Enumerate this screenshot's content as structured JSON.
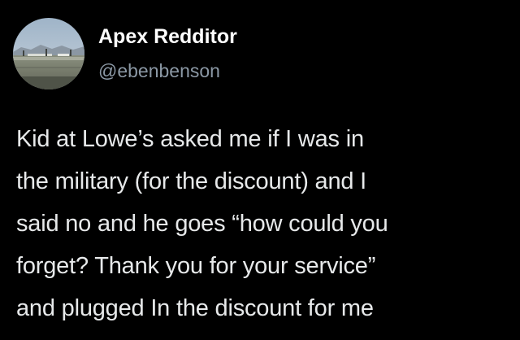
{
  "author": {
    "display_name": "Apex Redditor",
    "handle": "@ebenbenson",
    "avatar_icon": "avatar-landscape-photo"
  },
  "tweet": {
    "lines": [
      "Kid at Lowe’s asked me if I was in",
      "the military (for the discount) and I",
      "said no and he goes “how could you",
      "forget? Thank you for your service”",
      "and plugged In the discount for me"
    ]
  },
  "colors": {
    "background": "#000000",
    "primary_text": "#ffffff",
    "body_text": "#e7e9ea",
    "secondary_text": "#8b98a5"
  }
}
